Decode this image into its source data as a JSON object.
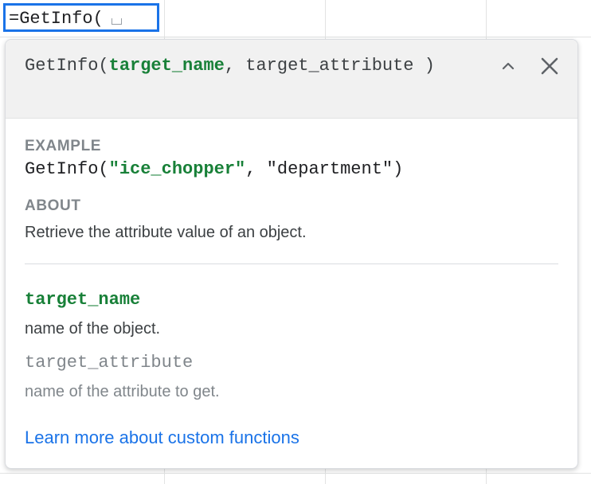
{
  "cell": {
    "formula": "=GetInfo("
  },
  "popup": {
    "signature": {
      "fn": "GetInfo(",
      "arg1": "target_name",
      "sep": ", ",
      "arg2": "target_attribute",
      "close": ")"
    },
    "collapse_icon": "chevron-up-icon",
    "close_icon": "close-icon",
    "example": {
      "label": "EXAMPLE",
      "fn": "GetInfo(",
      "arg1": "\"ice_chopper\"",
      "rest": ", \"department\")"
    },
    "about": {
      "label": "ABOUT",
      "text": "Retrieve the attribute value of an object."
    },
    "params": [
      {
        "name": "target_name",
        "description": "name of the object."
      },
      {
        "name": "target_attribute",
        "description": "name of the attribute to get."
      }
    ],
    "learn_more": "Learn more about custom functions"
  },
  "colors": {
    "accent_blue": "#1a73e8",
    "active_green": "#188038",
    "muted_gray": "#80868b"
  }
}
